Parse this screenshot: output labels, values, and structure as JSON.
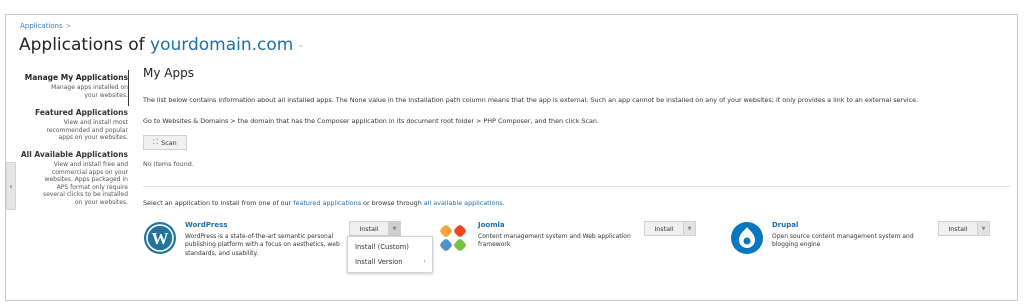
{
  "breadcrumb": {
    "label": "Applications",
    "separator": ">"
  },
  "page_title": {
    "prefix": "Applications of",
    "domain": "yourdomain.com",
    "caret": "⌄"
  },
  "collapse_handle": {
    "glyph": "‹"
  },
  "sidebar": {
    "items": [
      {
        "title": "Manage My Applications",
        "desc": [
          "Manage apps installed on",
          "your websites."
        ]
      },
      {
        "title": "Featured Applications",
        "desc": [
          "View and install most",
          "recommended and popular",
          "apps on your websites."
        ]
      },
      {
        "title": "All Available Applications",
        "desc": [
          "View and install free and",
          "commercial apps on your",
          "websites. Apps packaged in",
          "APS format only require",
          "several clicks to be installed",
          "on your websites."
        ]
      }
    ]
  },
  "main": {
    "heading": "My Apps",
    "para1": "The list below contains information about all installed apps. The None value in the Installation path column means that the app is external. Such an app cannot be installed on any of your websites; it only provides a link to an external service.",
    "para2": "Go to Websites & Domains > the domain that has the Composer application in its document root folder > PHP Composer, and then click Scan.",
    "scan_label": "Scan",
    "no_items": "No items found.",
    "select_prefix": "Select an application to install from one of our",
    "featured_link": "featured applications",
    "select_middle": "or browse through",
    "all_link": "all available applications",
    "select_suffix": "."
  },
  "apps": [
    {
      "name": "WordPress",
      "desc": [
        "WordPress is a state-of-the-art semantic personal",
        "publishing platform with a focus on aesthetics, web",
        "standards, and usability."
      ],
      "install_label": "Install",
      "color": "#21759b"
    },
    {
      "name": "Joomla",
      "desc": [
        "Content management system and Web application",
        "framework"
      ],
      "install_label": "Install",
      "color": "#f44321"
    },
    {
      "name": "Drupal",
      "desc": [
        "Open source content management system and",
        "blogging engine"
      ],
      "install_label": "Install",
      "color": "#0678be"
    }
  ],
  "install_dropdown": {
    "items": [
      "Install (Custom)",
      "Install Version"
    ],
    "submenu_glyph": "›"
  },
  "colors": {
    "link": "#1e6ea8",
    "border": "#c9c9c9"
  }
}
